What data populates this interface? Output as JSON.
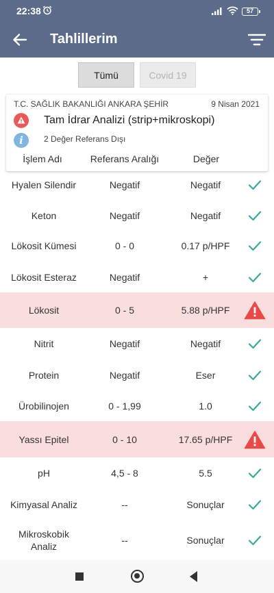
{
  "status_bar": {
    "time": "22:38",
    "battery": "57"
  },
  "header": {
    "title": "Tahlillerim"
  },
  "filters": [
    {
      "label": "Tümü",
      "selected": true
    },
    {
      "label": "Covid 19",
      "selected": false
    }
  ],
  "card": {
    "institution": "T.C. SAĞLIK BAKANLIĞI ANKARA ŞEHİR",
    "date": "9 Nisan 2021",
    "test_name": "Tam İdrar Analizi (strip+mikroskopi)",
    "info_symbol": "i",
    "note": "2 Değer Referans Dışı",
    "columns": {
      "name": "İşlem Adı",
      "reference": "Referans Aralığı",
      "value": "Değer"
    }
  },
  "colors": {
    "header_bg": "#5c6b8a",
    "alert_row_bg": "#fadede",
    "check": "#3aa89b",
    "alert": "#e84a4a"
  },
  "results": [
    {
      "name": "Hyalen Silendir",
      "reference": "Negatif",
      "value": "Negatif",
      "status": "normal"
    },
    {
      "name": "Keton",
      "reference": "Negatif",
      "value": "Negatif",
      "status": "normal"
    },
    {
      "name": "Lökosit Kümesi",
      "reference": "0 - 0",
      "value": "0.17 p/HPF",
      "status": "normal"
    },
    {
      "name": "Lökosit Esteraz",
      "reference": "Negatif",
      "value": "+",
      "status": "normal"
    },
    {
      "name": "Lökosit",
      "reference": "0 - 5",
      "value": "5.88 p/HPF",
      "status": "alert"
    },
    {
      "name": "Nitrit",
      "reference": "Negatif",
      "value": "Negatif",
      "status": "normal"
    },
    {
      "name": "Protein",
      "reference": "Negatif",
      "value": "Eser",
      "status": "normal"
    },
    {
      "name": "Ürobilinojen",
      "reference": "0 - 1,99",
      "value": "1.0",
      "status": "normal"
    },
    {
      "name": "Yassı Epitel",
      "reference": "0 - 10",
      "value": "17.65 p/HPF",
      "status": "alert"
    },
    {
      "name": "pH",
      "reference": "4,5 - 8",
      "value": "5.5",
      "status": "normal"
    },
    {
      "name": "Kimyasal Analiz",
      "reference": "--",
      "value": "Sonuçlar",
      "status": "normal"
    },
    {
      "name": "Mikroskobik Analiz",
      "reference": "--",
      "value": "Sonuçlar",
      "status": "normal"
    }
  ]
}
